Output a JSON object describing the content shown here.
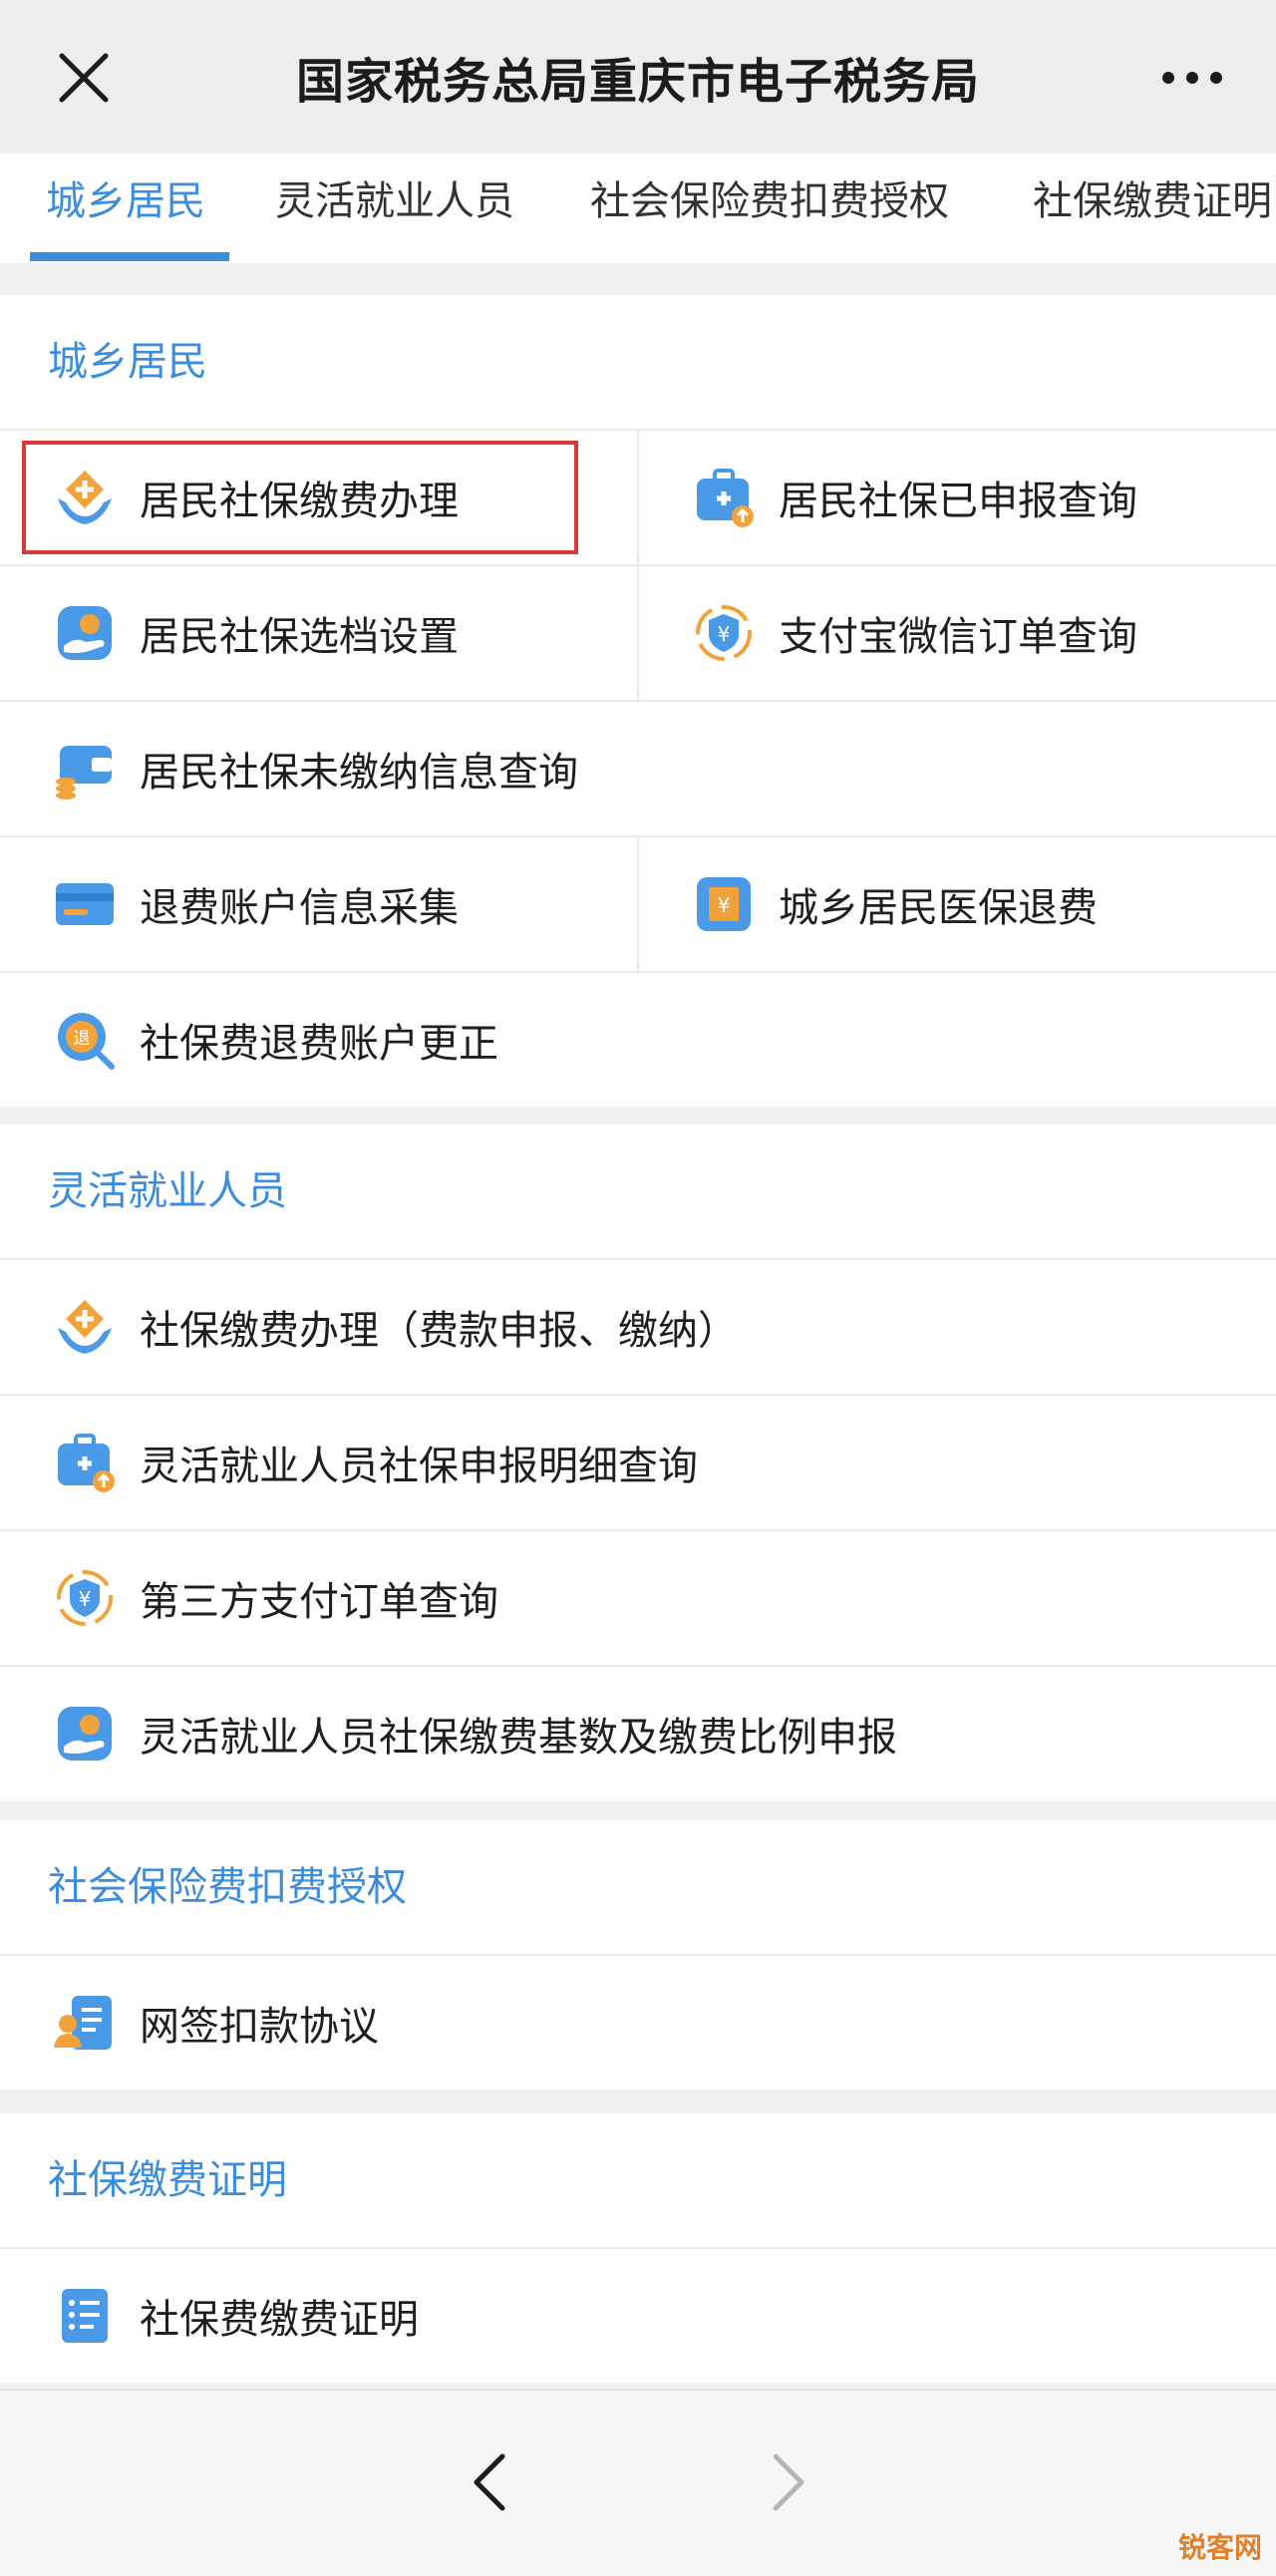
{
  "titlebar": {
    "title": "国家税务总局重庆市电子税务局",
    "close_icon": "close-icon",
    "more_icon": "more-icon"
  },
  "tabs": [
    {
      "label": "城乡居民",
      "active": true
    },
    {
      "label": "灵活就业人员",
      "active": false
    },
    {
      "label": "社会保险费扣费授权",
      "active": false
    },
    {
      "label": "社保缴费证明",
      "active": false
    }
  ],
  "sections": {
    "rural": {
      "title": "城乡居民",
      "items": [
        {
          "label": "居民社保缴费办理",
          "icon": "diamond-hands-icon"
        },
        {
          "label": "居民社保已申报查询",
          "icon": "medkit-icon"
        },
        {
          "label": "居民社保选档设置",
          "icon": "hand-coin-icon"
        },
        {
          "label": "支付宝微信订单查询",
          "icon": "shield-yuan-icon"
        },
        {
          "label": "居民社保未缴纳信息查询",
          "icon": "wallet-icon"
        },
        {
          "label": "退费账户信息采集",
          "icon": "card-icon"
        },
        {
          "label": "城乡居民医保退费",
          "icon": "atm-yuan-icon"
        },
        {
          "label": "社保费退费账户更正",
          "icon": "search-refund-icon"
        }
      ]
    },
    "flexible": {
      "title": "灵活就业人员",
      "items": [
        {
          "label": "社保缴费办理（费款申报、缴纳）",
          "icon": "diamond-hands-icon"
        },
        {
          "label": "灵活就业人员社保申报明细查询",
          "icon": "medkit-icon"
        },
        {
          "label": "第三方支付订单查询",
          "icon": "shield-yuan-icon"
        },
        {
          "label": "灵活就业人员社保缴费基数及缴费比例申报",
          "icon": "hand-coin-icon"
        }
      ]
    },
    "authorization": {
      "title": "社会保险费扣费授权",
      "items": [
        {
          "label": "网签扣款协议",
          "icon": "contract-user-icon"
        }
      ]
    },
    "certificate": {
      "title": "社保缴费证明",
      "items": [
        {
          "label": "社保费缴费证明",
          "icon": "document-list-icon"
        }
      ]
    }
  },
  "watermark": "锐客网",
  "colors": {
    "accent": "#3c8ddc",
    "highlight_border": "#d83a3a",
    "icon_orange": "#f2a23a",
    "icon_blue": "#4a9ae8"
  }
}
